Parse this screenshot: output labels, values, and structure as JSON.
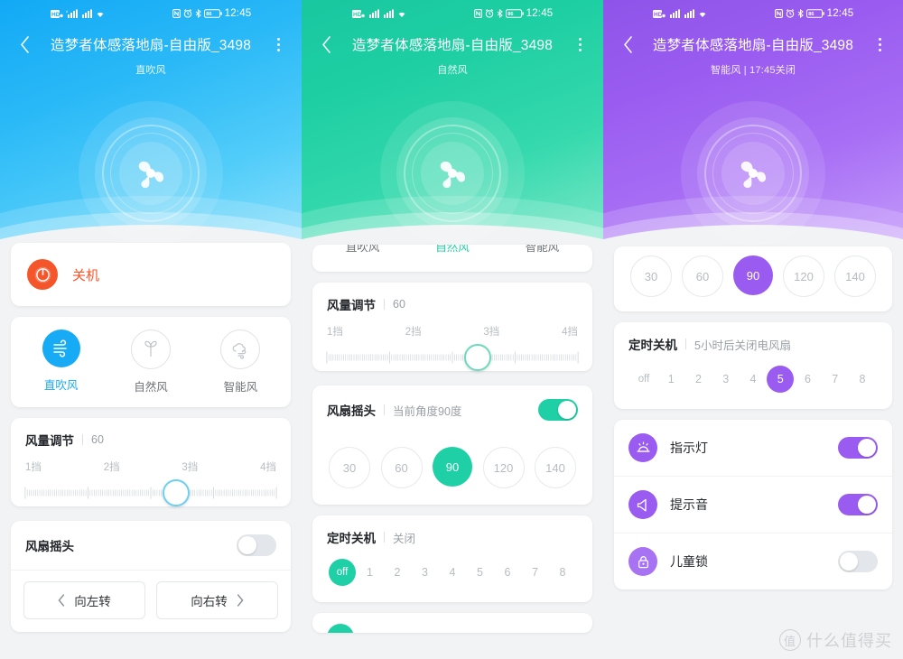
{
  "statusbar": {
    "icons": [
      "hd-voice-icon",
      "signal-bars-icon-1",
      "signal-bars-icon-2",
      "wifi-icon",
      "nfc-icon",
      "alarm-icon",
      "bluetooth-icon",
      "battery-icon"
    ],
    "battery_level": "86",
    "time": "12:45"
  },
  "colors": {
    "blue": "#17abf5",
    "green": "#1fcfa5",
    "purple": "#9a5cf0",
    "power_orange": "#f4552b",
    "muted": "#b6bcc2",
    "text": "#23262b"
  },
  "panels": [
    {
      "theme": "blue",
      "header": {
        "back_icon": "chevron-left-icon",
        "more_icon": "more-vertical-icon",
        "title": "造梦者体感落地扇-自由版_3498",
        "subtitle": "直吹风"
      },
      "power": {
        "label": "关机",
        "icon": "power-icon"
      },
      "modes": {
        "items": [
          {
            "label": "直吹风",
            "icon": "direct-wind-icon",
            "active": true
          },
          {
            "label": "自然风",
            "icon": "leaf-icon",
            "active": false
          },
          {
            "label": "智能风",
            "icon": "cloud-wind-icon",
            "active": false
          }
        ]
      },
      "speed": {
        "title": "风量调节",
        "value": "60",
        "gears": [
          "1挡",
          "2挡",
          "3挡",
          "4挡"
        ],
        "percent": 60
      },
      "oscillation": {
        "title": "风扇摇头",
        "value": "",
        "on": false,
        "turn_left": "向左转",
        "turn_right": "向右转",
        "left_icon": "chevron-left-icon",
        "right_icon": "chevron-right-icon"
      }
    },
    {
      "theme": "green",
      "header": {
        "back_icon": "chevron-left-icon",
        "more_icon": "more-vertical-icon",
        "title": "造梦者体感落地扇-自由版_3498",
        "subtitle": "自然风"
      },
      "modes_cut": {
        "items": [
          {
            "label": "直吹风",
            "active": false
          },
          {
            "label": "自然风",
            "active": true
          },
          {
            "label": "智能风",
            "active": false
          }
        ]
      },
      "speed": {
        "title": "风量调节",
        "value": "60",
        "gears": [
          "1挡",
          "2挡",
          "3挡",
          "4挡"
        ],
        "percent": 60
      },
      "oscillation": {
        "title": "风扇摇头",
        "value": "当前角度90度",
        "on": true,
        "angles": [
          "30",
          "60",
          "90",
          "120",
          "140"
        ],
        "selected_angle": "90"
      },
      "timer": {
        "title": "定时关机",
        "value": "关闭",
        "options": [
          "off",
          "1",
          "2",
          "3",
          "4",
          "5",
          "6",
          "7",
          "8"
        ],
        "selected": "off"
      }
    },
    {
      "theme": "purple",
      "header": {
        "back_icon": "chevron-left-icon",
        "more_icon": "more-vertical-icon",
        "title": "造梦者体感落地扇-自由版_3498",
        "subtitle": "智能风 | 17:45关闭"
      },
      "angles_cut": {
        "options": [
          "30",
          "60",
          "90",
          "120",
          "140"
        ],
        "selected": "90"
      },
      "timer": {
        "title": "定时关机",
        "value": "5小时后关闭电风扇",
        "options": [
          "off",
          "1",
          "2",
          "3",
          "4",
          "5",
          "6",
          "7",
          "8"
        ],
        "selected": "5"
      },
      "features": [
        {
          "label": "指示灯",
          "icon": "indicator-light-icon",
          "on": true
        },
        {
          "label": "提示音",
          "icon": "speaker-icon",
          "on": true
        },
        {
          "label": "儿童锁",
          "icon": "lock-icon",
          "on": false
        }
      ]
    }
  ],
  "watermark": {
    "mark": "值",
    "text": "什么值得买"
  }
}
